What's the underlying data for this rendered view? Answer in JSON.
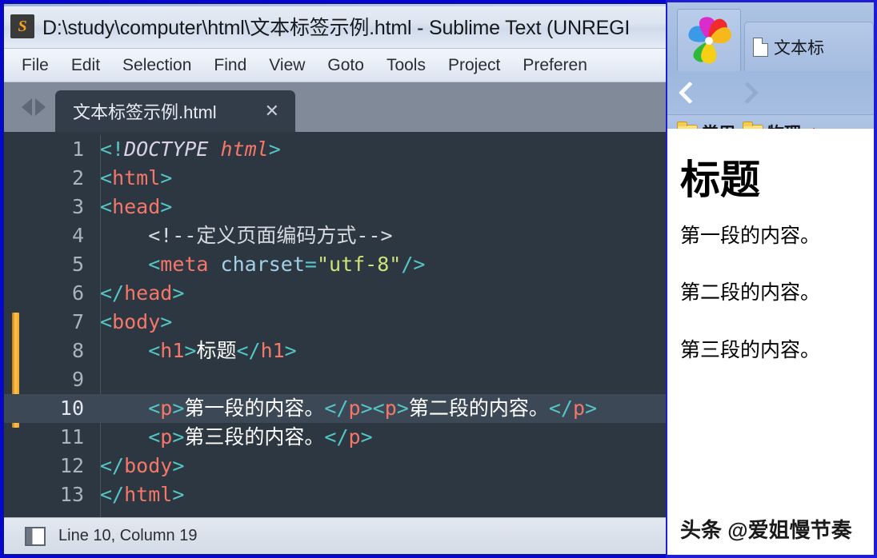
{
  "sublime": {
    "title": "D:\\study\\computer\\html\\文本标签示例.html - Sublime Text (UNREGI",
    "logo_letter": "S",
    "logo_icon": "sublime-text-icon",
    "menu": [
      {
        "label": "File"
      },
      {
        "label": "Edit"
      },
      {
        "label": "Selection"
      },
      {
        "label": "Find"
      },
      {
        "label": "View"
      },
      {
        "label": "Goto"
      },
      {
        "label": "Tools"
      },
      {
        "label": "Project"
      },
      {
        "label": "Preferen"
      }
    ],
    "tab": {
      "label": "文本标签示例.html",
      "close_label": "✕",
      "prev_icon": "triangle-left-icon",
      "next_icon": "triangle-right-icon"
    },
    "editor": {
      "active_line": 10,
      "line_numbers": [
        "1",
        "2",
        "3",
        "4",
        "5",
        "6",
        "7",
        "8",
        "9",
        "10",
        "11",
        "12",
        "13"
      ],
      "lines": [
        {
          "n": 1,
          "tokens": [
            {
              "t": "<!",
              "c": "tk-punct"
            },
            {
              "t": "DOCTYPE ",
              "c": "tk-doct"
            },
            {
              "t": "html",
              "c": "tk-doctv"
            },
            {
              "t": ">",
              "c": "tk-punct"
            }
          ]
        },
        {
          "n": 2,
          "tokens": [
            {
              "t": "<",
              "c": "tk-punct"
            },
            {
              "t": "html",
              "c": "tk-tag"
            },
            {
              "t": ">",
              "c": "tk-punct"
            }
          ]
        },
        {
          "n": 3,
          "tokens": [
            {
              "t": "<",
              "c": "tk-punct"
            },
            {
              "t": "head",
              "c": "tk-tag"
            },
            {
              "t": ">",
              "c": "tk-punct"
            }
          ]
        },
        {
          "n": 4,
          "tokens": [
            {
              "t": "    <!--定义页面编码方式-->",
              "c": "tk-cmt"
            }
          ]
        },
        {
          "n": 5,
          "tokens": [
            {
              "t": "    <",
              "c": "tk-punct"
            },
            {
              "t": "meta",
              "c": "tk-tag"
            },
            {
              "t": " charset",
              "c": "tk-attr"
            },
            {
              "t": "=",
              "c": "tk-punct"
            },
            {
              "t": "\"utf-8\"",
              "c": "tk-str"
            },
            {
              "t": "/>",
              "c": "tk-punct"
            }
          ]
        },
        {
          "n": 6,
          "tokens": [
            {
              "t": "</",
              "c": "tk-punct"
            },
            {
              "t": "head",
              "c": "tk-tag"
            },
            {
              "t": ">",
              "c": "tk-punct"
            }
          ]
        },
        {
          "n": 7,
          "tokens": [
            {
              "t": "<",
              "c": "tk-punct"
            },
            {
              "t": "body",
              "c": "tk-tag"
            },
            {
              "t": ">",
              "c": "tk-punct"
            }
          ]
        },
        {
          "n": 8,
          "tokens": [
            {
              "t": "    <",
              "c": "tk-punct"
            },
            {
              "t": "h1",
              "c": "tk-tag"
            },
            {
              "t": ">",
              "c": "tk-punct"
            },
            {
              "t": "标题",
              "c": "tk-txt"
            },
            {
              "t": "</",
              "c": "tk-punct"
            },
            {
              "t": "h1",
              "c": "tk-tag"
            },
            {
              "t": ">",
              "c": "tk-punct"
            }
          ]
        },
        {
          "n": 9,
          "tokens": [
            {
              "t": "",
              "c": "tk-txt"
            }
          ]
        },
        {
          "n": 10,
          "tokens": [
            {
              "t": "    <",
              "c": "tk-punct"
            },
            {
              "t": "p",
              "c": "tk-tag"
            },
            {
              "t": ">",
              "c": "tk-punct"
            },
            {
              "t": "第一段的内容。",
              "c": "tk-txt"
            },
            {
              "t": "</",
              "c": "tk-punct"
            },
            {
              "t": "p",
              "c": "tk-tag"
            },
            {
              "t": ">",
              "c": "tk-punct"
            },
            {
              "t": "<",
              "c": "tk-punct"
            },
            {
              "t": "p",
              "c": "tk-tag"
            },
            {
              "t": ">",
              "c": "tk-punct"
            },
            {
              "t": "第二段的内容。",
              "c": "tk-txt"
            },
            {
              "t": "</",
              "c": "tk-punct"
            },
            {
              "t": "p",
              "c": "tk-tag"
            },
            {
              "t": ">",
              "c": "tk-punct"
            }
          ]
        },
        {
          "n": 11,
          "tokens": [
            {
              "t": "    <",
              "c": "tk-punct"
            },
            {
              "t": "p",
              "c": "tk-tag"
            },
            {
              "t": ">",
              "c": "tk-punct"
            },
            {
              "t": "第三段的内容。",
              "c": "tk-txt"
            },
            {
              "t": "</",
              "c": "tk-punct"
            },
            {
              "t": "p",
              "c": "tk-tag"
            },
            {
              "t": ">",
              "c": "tk-punct"
            }
          ]
        },
        {
          "n": 12,
          "tokens": [
            {
              "t": "</",
              "c": "tk-punct"
            },
            {
              "t": "body",
              "c": "tk-tag"
            },
            {
              "t": ">",
              "c": "tk-punct"
            }
          ]
        },
        {
          "n": 13,
          "tokens": [
            {
              "t": "</",
              "c": "tk-punct"
            },
            {
              "t": "html",
              "c": "tk-tag"
            },
            {
              "t": ">",
              "c": "tk-punct"
            }
          ]
        }
      ]
    },
    "statusbar": {
      "icon": "sidebar-toggle-icon",
      "text": "Line 10, Column 19"
    }
  },
  "browser": {
    "logo_icon": "360-browser-pinwheel-icon",
    "tab": {
      "icon": "document-icon",
      "label": "文本标"
    },
    "nav": {
      "back_icon": "chevron-left-icon",
      "forward_icon": "chevron-right-icon"
    },
    "bookmarks": [
      {
        "icon": "folder-icon",
        "label": "常用"
      },
      {
        "icon": "folder-icon",
        "label": "物理"
      }
    ],
    "bookmark_extra_icon": "red-bookmark-icon",
    "bookmark_extra_glyph": "❧",
    "page": {
      "h1": "标题",
      "paragraphs": [
        "第一段的内容。",
        "第二段的内容。",
        "第三段的内容。"
      ]
    },
    "watermark": "头条 @爱姐慢节奏"
  },
  "colors": {
    "desktop_blue": "#0606cf",
    "editor_bg": "#2d3741",
    "active_line": "#3c4855",
    "tabstrip": "#818a99",
    "accent_orange": "#f7a01d",
    "syntax_tag": "#f4776a",
    "syntax_punct": "#55c6c6",
    "syntax_string": "#cfe37a",
    "syntax_attr": "#a2d0e8"
  }
}
